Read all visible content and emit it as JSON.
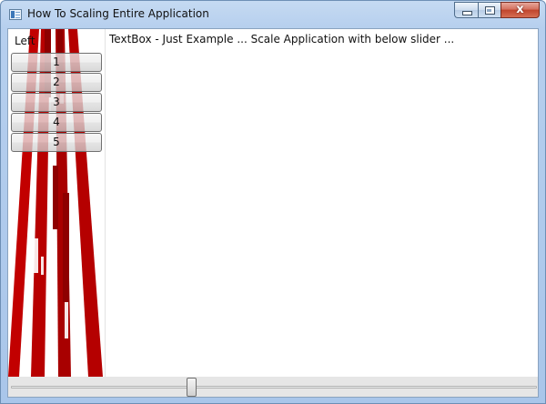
{
  "window": {
    "title": "How To Scaling Entire Application",
    "caption_close_glyph": "x",
    "accent": "#b6cfee"
  },
  "left_panel": {
    "label": "Left",
    "buttons": [
      "1",
      "2",
      "3",
      "4",
      "5"
    ],
    "background_color": "#b00000"
  },
  "textbox": {
    "text": "TextBox - Just Example ... Scale Application with below slider ..."
  },
  "slider": {
    "value_fraction": 0.34
  },
  "icons": {
    "app": "app-window-icon",
    "minimize": "minimize-icon",
    "maximize": "maximize-icon",
    "close": "close-icon"
  }
}
